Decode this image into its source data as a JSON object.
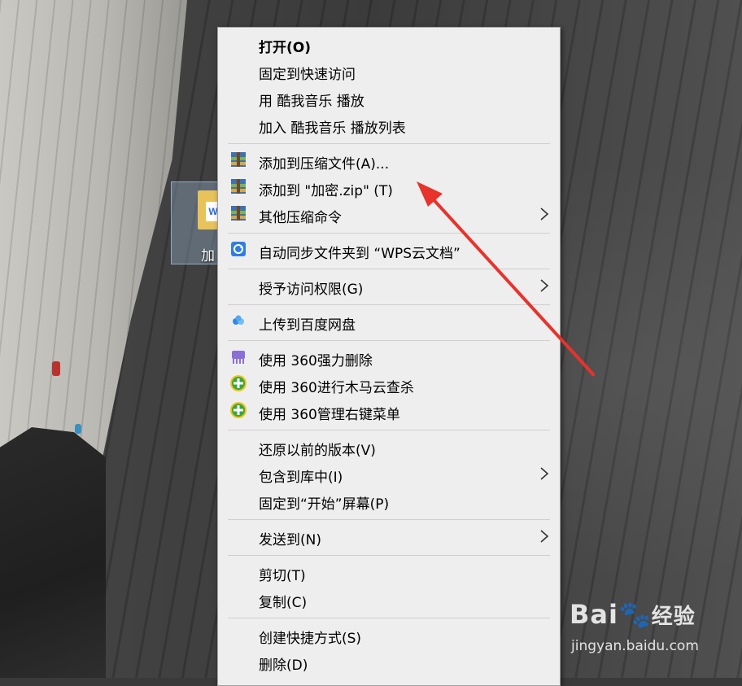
{
  "desktop": {
    "icon_label": "加"
  },
  "menu": {
    "items": [
      {
        "label": "打开(O)",
        "icon": "",
        "submenu": false
      },
      {
        "label": "固定到快速访问",
        "icon": "",
        "submenu": false
      },
      {
        "label": "用 酷我音乐 播放",
        "icon": "",
        "submenu": false
      },
      {
        "label": "加入 酷我音乐 播放列表",
        "icon": "",
        "submenu": false
      },
      {
        "label": "添加到压缩文件(A)...",
        "icon": "winrar-icon",
        "submenu": false
      },
      {
        "label": "添加到 \"加密.zip\" (T)",
        "icon": "winrar-icon",
        "submenu": false
      },
      {
        "label": "其他压缩命令",
        "icon": "winrar-icon",
        "submenu": true
      },
      {
        "label": "自动同步文件夹到 “WPS云文档”",
        "icon": "wps-cloud-sync-icon",
        "submenu": false
      },
      {
        "label": "授予访问权限(G)",
        "icon": "",
        "submenu": true
      },
      {
        "label": "上传到百度网盘",
        "icon": "baidu-netdisk-icon",
        "submenu": false
      },
      {
        "label": "使用 360强力删除",
        "icon": "360-shredder-icon",
        "submenu": false
      },
      {
        "label": "使用 360进行木马云查杀",
        "icon": "360-security-icon",
        "submenu": false
      },
      {
        "label": "使用 360管理右键菜单",
        "icon": "360-security-icon",
        "submenu": false
      },
      {
        "label": "还原以前的版本(V)",
        "icon": "",
        "submenu": false
      },
      {
        "label": "包含到库中(I)",
        "icon": "",
        "submenu": true
      },
      {
        "label": "固定到“开始”屏幕(P)",
        "icon": "",
        "submenu": false
      },
      {
        "label": "发送到(N)",
        "icon": "",
        "submenu": true
      },
      {
        "label": "剪切(T)",
        "icon": "",
        "submenu": false
      },
      {
        "label": "复制(C)",
        "icon": "",
        "submenu": false
      },
      {
        "label": "创建快捷方式(S)",
        "icon": "",
        "submenu": false
      },
      {
        "label": "删除(D)",
        "icon": "",
        "submenu": false
      }
    ]
  },
  "watermark": {
    "brand_latin": "Bai",
    "brand_cn": "经验",
    "url": "jingyan.baidu.com"
  },
  "colors": {
    "annotation_arrow": "#e8322c",
    "menu_background": "#eeeeee"
  }
}
